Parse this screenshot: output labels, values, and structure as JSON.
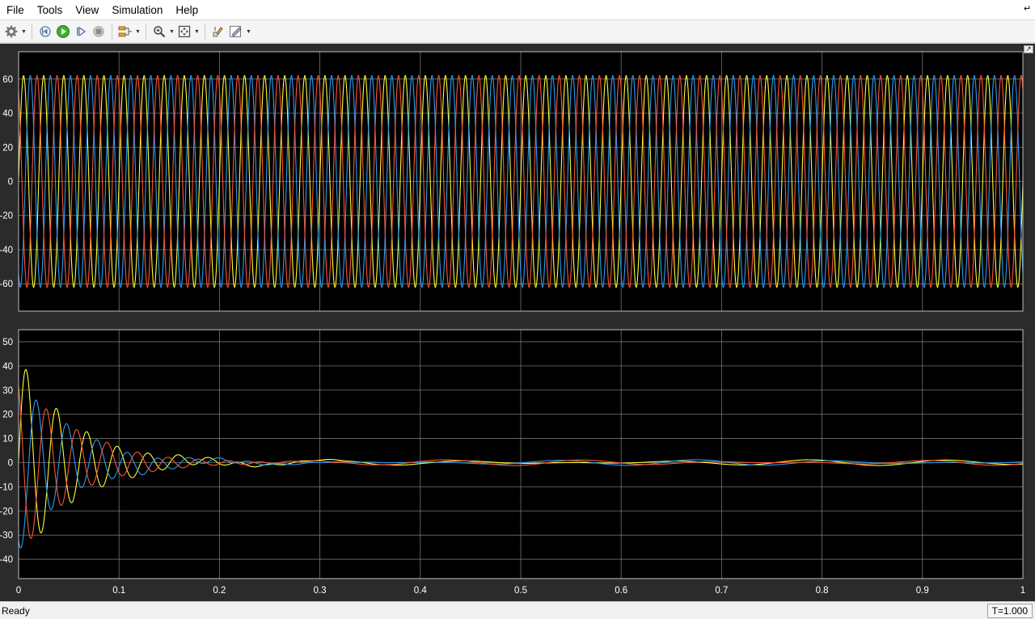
{
  "menu": [
    "File",
    "Tools",
    "View",
    "Simulation",
    "Help"
  ],
  "toolbar": {
    "icons": [
      "gear-icon",
      "step-back-icon",
      "run-icon",
      "step-forward-icon",
      "stop-icon",
      "signal-selector-icon",
      "zoom-icon",
      "fit-to-view-icon",
      "highlight-icon",
      "style-icon"
    ]
  },
  "status": {
    "text": "Ready",
    "time": "T=1.000"
  },
  "colors": {
    "series_1": "#ffff33",
    "series_2": "#2a9df4",
    "series_3": "#ff5533",
    "plot_bg": "#000000",
    "frame_bg": "#2b2b2b",
    "grid": "#9a9a9a"
  },
  "chart_data": [
    {
      "type": "line",
      "title": "",
      "xlabel": "",
      "ylabel": "",
      "xlim": [
        0,
        1
      ],
      "ylim": [
        -76,
        76
      ],
      "yticks": [
        "60",
        "40",
        "20",
        "0",
        "-20",
        "-40",
        "-60"
      ],
      "ytick_values": [
        60,
        40,
        20,
        0,
        -20,
        -40,
        -60
      ],
      "xticks": [],
      "grid": true,
      "description_of_signals": "three-phase sinusoids, constant amplitude",
      "series": [
        {
          "color": "#ffff33",
          "amplitude": 62,
          "frequency_hz": 50,
          "phase_deg": 0
        },
        {
          "color": "#2a9df4",
          "amplitude": 62,
          "frequency_hz": 50,
          "phase_deg": -120
        },
        {
          "color": "#ff5533",
          "amplitude": 62,
          "frequency_hz": 50,
          "phase_deg": 120
        }
      ]
    },
    {
      "type": "line",
      "title": "",
      "xlabel": "",
      "ylabel": "",
      "xlim": [
        0,
        1
      ],
      "ylim": [
        -48,
        55
      ],
      "yticks": [
        "50",
        "40",
        "30",
        "20",
        "10",
        "0",
        "-10",
        "-20",
        "-30",
        "-40"
      ],
      "ytick_values": [
        50,
        40,
        30,
        20,
        10,
        0,
        -10,
        -20,
        -30,
        -40
      ],
      "xticks": [
        "0",
        "0.1",
        "0.2",
        "0.3",
        "0.4",
        "0.5",
        "0.6",
        "0.7",
        "0.8",
        "0.9",
        "1"
      ],
      "xtick_values": [
        0,
        0.1,
        0.2,
        0.3,
        0.4,
        0.5,
        0.6,
        0.7,
        0.8,
        0.9,
        1
      ],
      "grid": true,
      "description_of_signals": "three-phase decaying oscillations settling near 0 by 0.2 s",
      "series": [
        {
          "color": "#ffff33",
          "initial_amplitude": 44,
          "frequency_hz": 33,
          "decay_tau_s": 0.055,
          "phase_deg": 0,
          "residual": 1.2
        },
        {
          "color": "#2a9df4",
          "initial_amplitude": 36,
          "frequency_hz": 33,
          "decay_tau_s": 0.055,
          "phase_deg": -120,
          "residual": 1.2
        },
        {
          "color": "#ff5533",
          "initial_amplitude": 38,
          "frequency_hz": 33,
          "decay_tau_s": 0.055,
          "phase_deg": 120,
          "residual": 1.2
        }
      ]
    }
  ]
}
